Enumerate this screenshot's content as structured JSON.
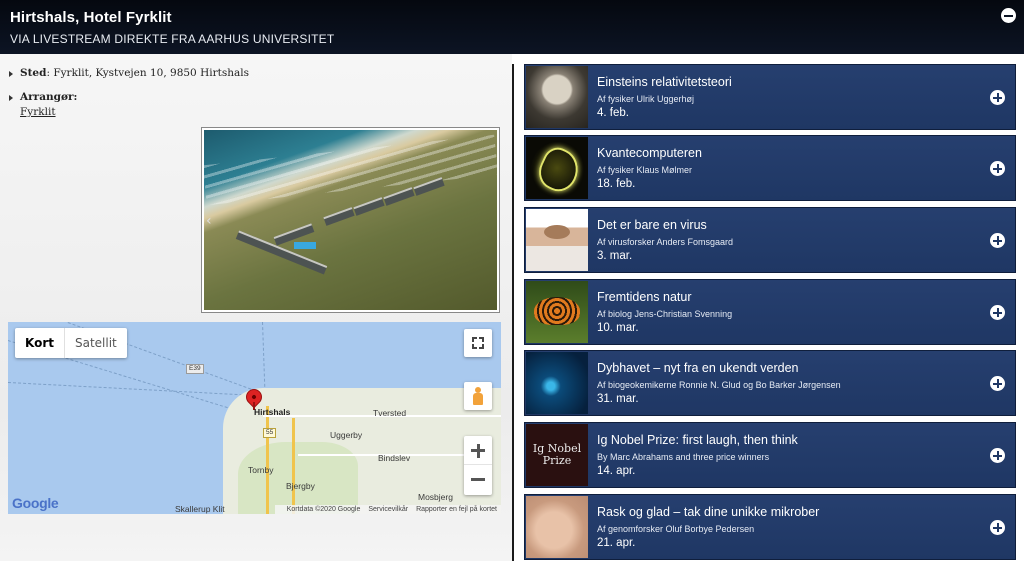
{
  "header": {
    "title": "Hirtshals, Hotel Fyrklit",
    "subtitle": "VIA LIVESTREAM DIREKTE FRA AARHUS UNIVERSITET"
  },
  "venue": {
    "place_label": "Sted",
    "place_value": ": Fyrklit, Kystvejen 10, 9850 Hirtshals",
    "organizer_label": "Arrangør:",
    "organizer_link": "Fyrklit"
  },
  "map": {
    "type_map": "Kort",
    "type_satellite": "Satellit",
    "labels": {
      "hirtshals": "Hirtshals",
      "tversted": "Tversted",
      "uggerby": "Uggerby",
      "bindslev": "Bindslev",
      "tornby": "Tornby",
      "bjergby": "Bjergby",
      "mosbjerg": "Mosbjerg",
      "skallerup": "Skallerup Klit"
    },
    "shields": {
      "e39": "E39",
      "r55": "55"
    },
    "google": "Google",
    "attribution": {
      "data": "Kortdata ©2020 Google",
      "terms": "Servicevilkår",
      "report": "Rapporter en fejl på kortet"
    }
  },
  "events": [
    {
      "title": "Einsteins relativitetsteori",
      "speaker": "Af fysiker Ulrik Uggerhøj",
      "date": "4. feb.",
      "thumb": "einstein-photo"
    },
    {
      "title": "Kvantecomputeren",
      "speaker": "Af fysiker Klaus Mølmer",
      "date": "18. feb.",
      "thumb": "quantum-light-photo"
    },
    {
      "title": "Det er bare en virus",
      "speaker": "Af virusforsker Anders Fomsgaard",
      "date": "3. mar.",
      "thumb": "sneezing-woman-photo"
    },
    {
      "title": "Fremtidens natur",
      "speaker": "Af biolog Jens-Christian Svenning",
      "date": "10. mar.",
      "thumb": "butterfly-photo"
    },
    {
      "title": "Dybhavet – nyt fra en ukendt verden",
      "speaker": "Af biogeokemikerne Ronnie N. Glud og Bo Barker Jørgensen",
      "date": "31. mar.",
      "thumb": "deep-sea-photo"
    },
    {
      "title": "Ig Nobel Prize: first laugh, then think",
      "speaker": "By Marc Abrahams and three price winners",
      "date": "14. apr.",
      "thumb": "ig-nobel-logo",
      "thumb_line1": "Ig Nobel",
      "thumb_line2": "Prize"
    },
    {
      "title": "Rask og glad – tak dine unikke mikrober",
      "speaker": "Af genomforsker Oluf Borbye Pedersen",
      "date": "21. apr.",
      "thumb": "belly-hands-photo"
    }
  ],
  "colors": {
    "header_bg": "#0c1424",
    "card_bg": "#1f3764",
    "map_water": "#a9c9ee",
    "pin": "#d22222"
  }
}
